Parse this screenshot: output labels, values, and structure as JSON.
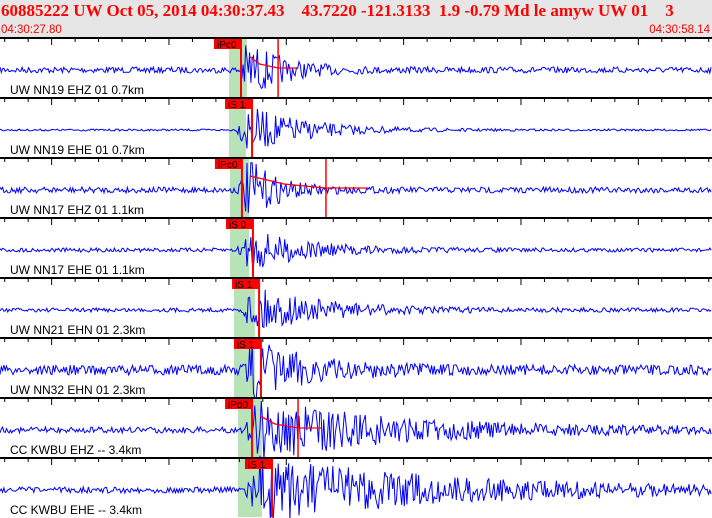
{
  "header": {
    "title": "60885222 UW Oct 05, 2014 04:30:37.43    43.7220 -121.3133  1.9 -0.79 Md le amyw UW 01    3",
    "start_time": "04:30:27.80",
    "end_time": "04:30:58.14"
  },
  "time_window_seconds": 30.34,
  "colors": {
    "trace": "#0000ff",
    "pick": "#ff0000",
    "window": "#b8e2b8",
    "header_bg": "#e6e6e6"
  },
  "traces": [
    {
      "label": "UW NN19 EHZ 01 0.7km",
      "pick": "iPc0",
      "pick_s": 10.27,
      "win": [
        9.76,
        10.52
      ],
      "coda_s": 11.85
    },
    {
      "label": "UW NN19 EHE 01 0.7km",
      "pick": "iS 1",
      "pick_s": 10.74,
      "win": [
        9.76,
        10.48
      ]
    },
    {
      "label": "UW NN17 EHZ 01 1.1km",
      "pick": "iPc0",
      "pick_s": 10.31,
      "win": [
        9.8,
        10.61
      ],
      "coda_s": 13.89
    },
    {
      "label": "UW NN17 EHE 01 1.1km",
      "pick": "iS 0",
      "pick_s": 10.78,
      "win": [
        9.8,
        10.61
      ]
    },
    {
      "label": "UW NN21 EHN 01 2.3km",
      "pick": "iS 1",
      "pick_s": 11.04,
      "win": [
        9.97,
        10.86
      ]
    },
    {
      "label": "UW NN32 EHN 01 2.3km",
      "pick": "iS 1",
      "pick_s": 11.12,
      "win": [
        9.97,
        10.86
      ]
    },
    {
      "label": "CC KWBU EHZ -- 3.4km",
      "pick": "iPd0",
      "pick_s": 10.74,
      "win": [
        10.14,
        11.16
      ],
      "coda_s": 12.7
    },
    {
      "label": "CC KWBU EHE -- 3.4km",
      "pick": "iS 1",
      "pick_s": 11.59,
      "win": [
        10.14,
        11.16
      ]
    }
  ]
}
